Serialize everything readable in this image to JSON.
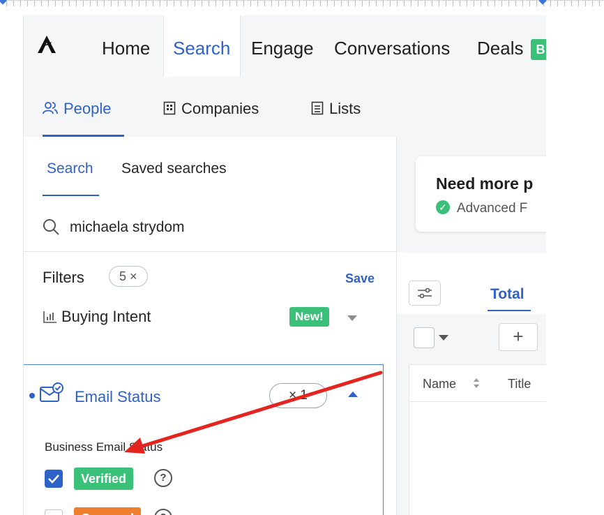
{
  "topnav": {
    "items": [
      "Home",
      "Search",
      "Engage",
      "Conversations",
      "Deals"
    ],
    "deals_badge": "B"
  },
  "subnav": {
    "items": [
      "People",
      "Companies",
      "Lists"
    ]
  },
  "left": {
    "tabs": [
      "Search",
      "Saved searches"
    ],
    "search_value": "michaela strydom",
    "filters_label": "Filters",
    "filters_count": "5 ×",
    "save_label": "Save",
    "buying_intent": {
      "label": "Buying Intent",
      "badge": "New!"
    },
    "email_status": {
      "title": "Email Status",
      "pill": "× 1",
      "section_label": "Business Email Status",
      "options": [
        {
          "label": "Verified",
          "checked": true,
          "color": "#3bc07a"
        },
        {
          "label": "Guessed",
          "checked": false,
          "color": "#ee7d2c"
        }
      ],
      "help": "?"
    }
  },
  "right": {
    "card_title": "Need more p",
    "card_sub": "Advanced F",
    "total_tab": "Total",
    "add_label": "+",
    "table_headers": [
      "Name",
      "Title"
    ]
  },
  "colors": {
    "accent": "#2f62c9",
    "green": "#3bc07a",
    "orange": "#ee7d2c",
    "annotation_arrow": "#e5231f"
  }
}
